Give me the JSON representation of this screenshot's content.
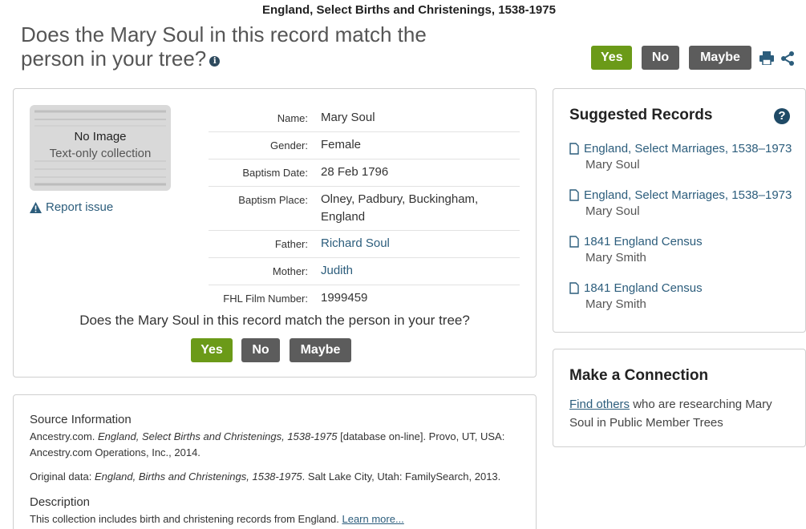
{
  "collection_title": "England, Select Births and Christenings, 1538-1975",
  "question": "Does the Mary Soul in this record match the person in your tree?",
  "info_icon_glyph": "i",
  "actions": {
    "yes": "Yes",
    "no": "No",
    "maybe": "Maybe"
  },
  "icons": {
    "print": "print-icon",
    "share": "share-icon",
    "info": "info-icon",
    "warning": "warning-icon",
    "document": "document-icon",
    "help": "help-icon"
  },
  "colors": {
    "yes": "#6b9a18",
    "neutral": "#5c5c5c",
    "link": "#2c5d7c"
  },
  "image": {
    "no_image": "No Image",
    "text_only": "Text-only collection"
  },
  "report_issue": "Report issue",
  "fields": [
    {
      "label": "Name:",
      "value": "Mary Soul",
      "link": false
    },
    {
      "label": "Gender:",
      "value": "Female",
      "link": false
    },
    {
      "label": "Baptism Date:",
      "value": "28 Feb 1796",
      "link": false
    },
    {
      "label": "Baptism Place:",
      "value": "Olney, Padbury, Buckingham, England",
      "link": false
    },
    {
      "label": "Father:",
      "value": "Richard Soul",
      "link": true
    },
    {
      "label": "Mother:",
      "value": "Judith",
      "link": true
    },
    {
      "label": "FHL Film Number:",
      "value": "1999459",
      "link": false
    }
  ],
  "source": {
    "heading": "Source Information",
    "citation_pre": "Ancestry.com. ",
    "citation_title": "England, Select Births and Christenings, 1538-1975",
    "citation_post": " [database on-line]. Provo, UT, USA: Ancestry.com Operations, Inc., 2014.",
    "original_pre": "Original data: ",
    "original_title": "England, Births and Christenings, 1538-1975",
    "original_post": ". Salt Lake City, Utah: FamilySearch, 2013.",
    "description_heading": "Description",
    "description": "This collection includes birth and christening records from England. ",
    "learn_more": "Learn more..."
  },
  "suggested": {
    "heading": "Suggested Records",
    "help_glyph": "?",
    "items": [
      {
        "title": "England, Select Marriages, 1538–1973",
        "name": "Mary Soul"
      },
      {
        "title": "England, Select Marriages, 1538–1973",
        "name": "Mary Soul"
      },
      {
        "title": "1841 England Census",
        "name": "Mary Smith"
      },
      {
        "title": "1841 England Census",
        "name": "Mary Smith"
      }
    ]
  },
  "connection": {
    "heading": "Make a Connection",
    "link": "Find others",
    "text": " who are researching Mary Soul in Public Member Trees"
  }
}
